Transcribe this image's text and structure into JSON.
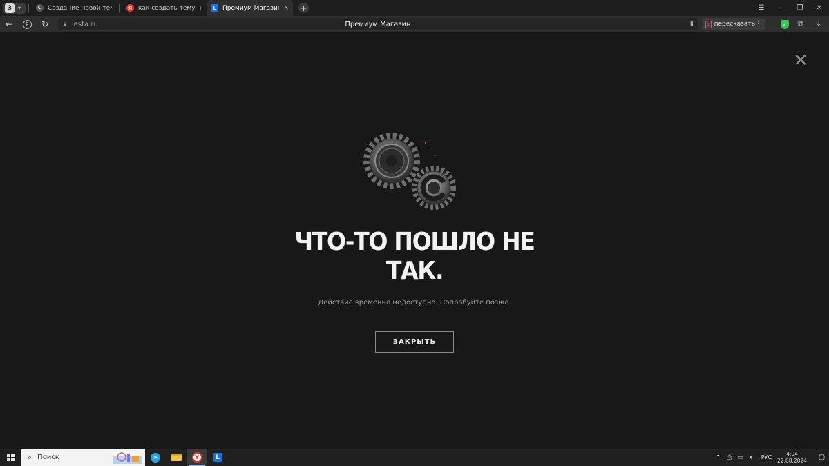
{
  "browser": {
    "tab_count": "3",
    "tabs": [
      {
        "label": "Создание новой темы - О",
        "active": false
      },
      {
        "label": "как создать тему на фору",
        "active": false
      },
      {
        "label": "Премиум Магазин",
        "active": true
      }
    ],
    "address": {
      "domain": "lesta.ru",
      "page_title": "Премиум Магазин"
    },
    "retell_label": "пересказать"
  },
  "page": {
    "error_title": "ЧТО-ТО ПОШЛО НЕ ТАК.",
    "error_message": "Действие временно недоступно. Попробуйте позже.",
    "close_button_label": "ЗАКРЫТЬ"
  },
  "taskbar": {
    "search_placeholder": "Поиск",
    "language": "РУС",
    "time": "4:04",
    "date": "22.08.2024"
  },
  "colors": {
    "page_background": "#181818",
    "button_border": "#8a8a8a",
    "shield_green": "#3fbf5a"
  }
}
